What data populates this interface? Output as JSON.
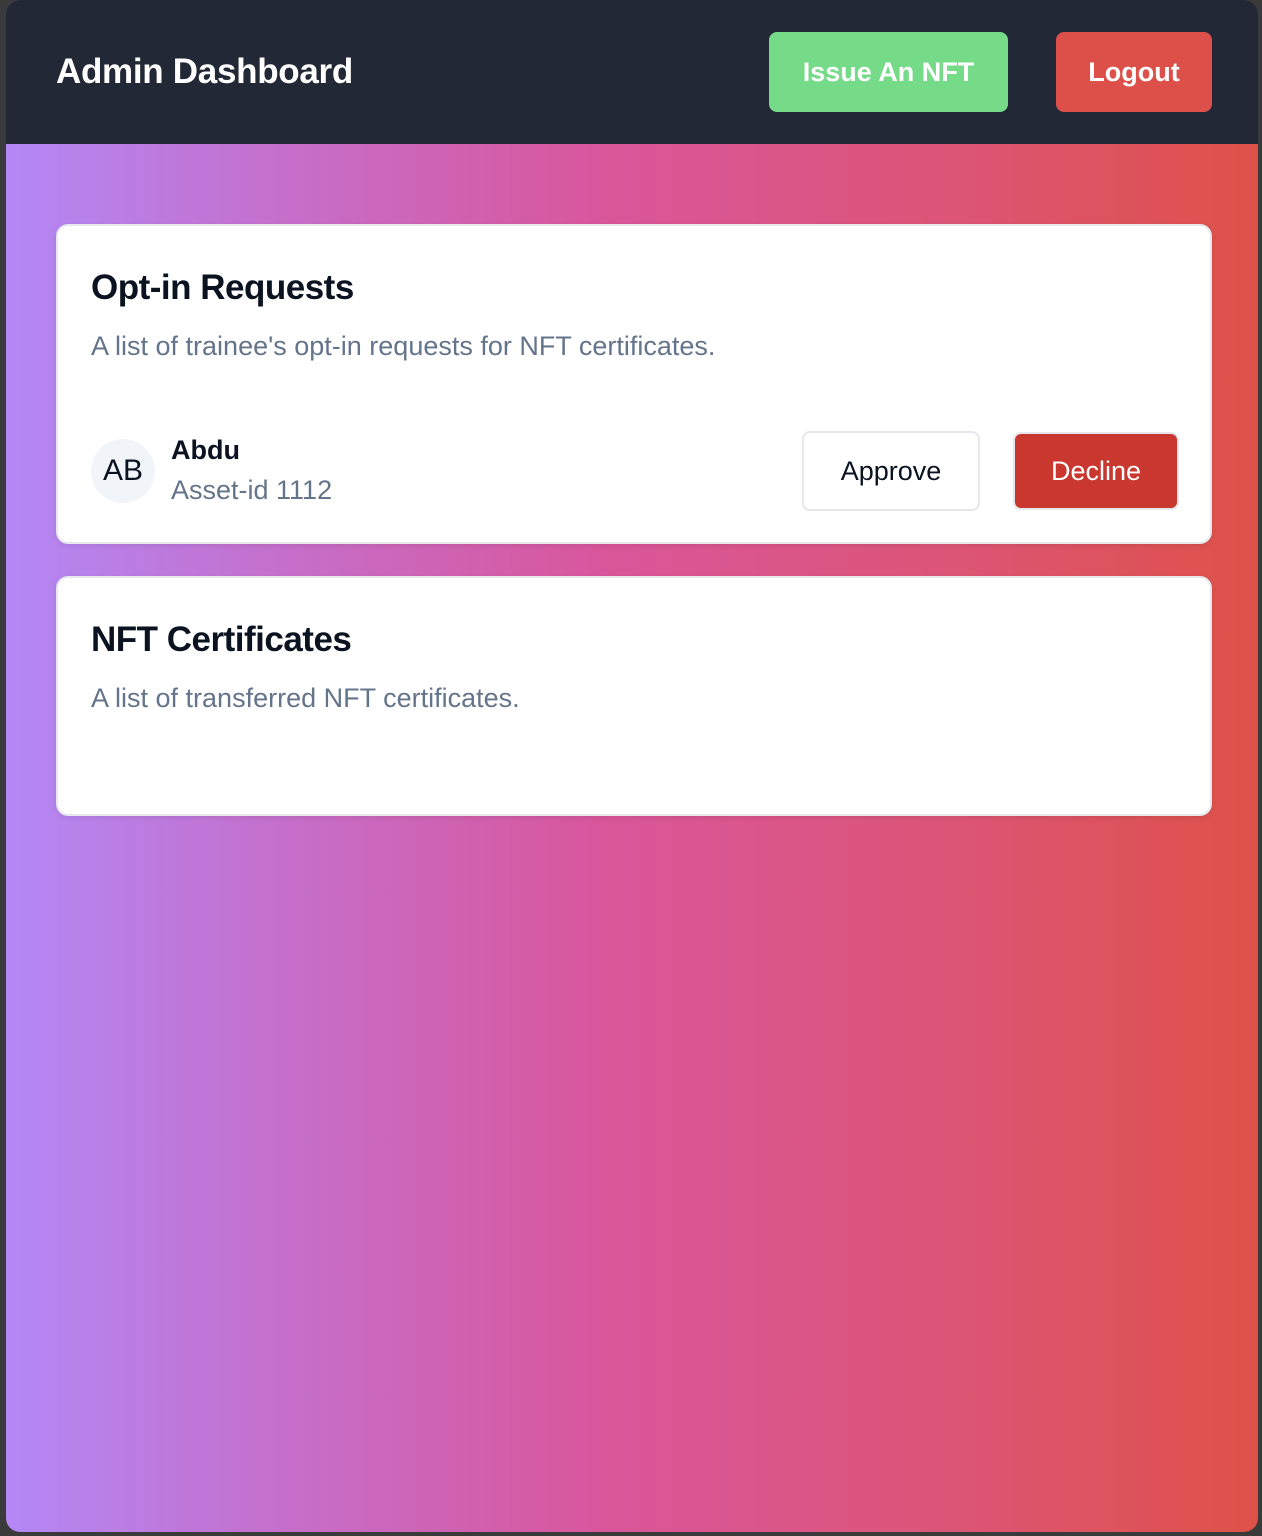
{
  "header": {
    "title": "Admin Dashboard",
    "issue_button": "Issue An NFT",
    "logout_button": "Logout"
  },
  "requests": {
    "title": "Opt-in Requests",
    "description": "A list of trainee's opt-in requests for NFT certificates.",
    "items": [
      {
        "initials": "AB",
        "name": "Abdu",
        "asset": "Asset-id 1112",
        "approve_label": "Approve",
        "decline_label": "Decline"
      }
    ]
  },
  "certificates": {
    "title": "NFT Certificates",
    "description": "A list of transferred NFT certificates.",
    "items": []
  },
  "colors": {
    "header_bg": "#222836",
    "issue_button": "#76db89",
    "logout_button": "#dd5049",
    "decline_button": "#c9372f",
    "gradient_start": "#b388f6",
    "gradient_mid": "#d9569a",
    "gradient_end": "#de5148"
  }
}
